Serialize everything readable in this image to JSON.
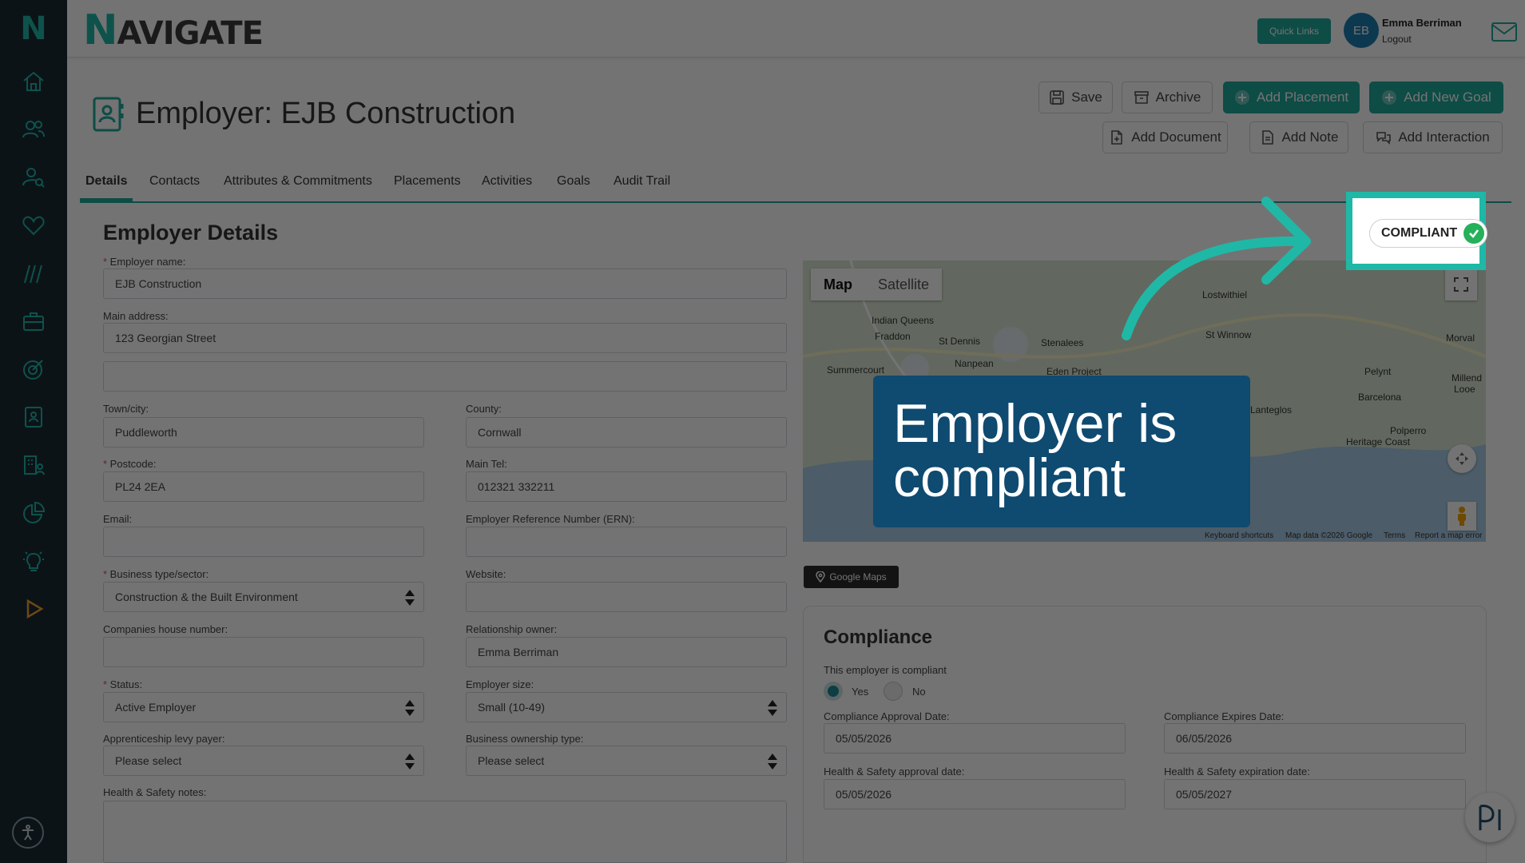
{
  "brand": {
    "initial": "N",
    "rest": "AVIGATE"
  },
  "sidebar": {
    "logo": "N"
  },
  "topbar": {
    "quick_links": "Quick Links",
    "avatar_initials": "EB",
    "user_name": "Emma Berriman",
    "logout": "Logout"
  },
  "header": {
    "title": "Employer: EJB Construction",
    "buttons": {
      "save": "Save",
      "archive": "Archive",
      "add_placement": "Add Placement",
      "add_new_goal": "Add New Goal",
      "add_document": "Add Document",
      "add_note": "Add Note",
      "add_interaction": "Add Interaction"
    }
  },
  "tabs": [
    "Details",
    "Contacts",
    "Attributes & Commitments",
    "Placements",
    "Activities",
    "Goals",
    "Audit Trail"
  ],
  "form": {
    "section_title": "Employer Details",
    "employer_name": {
      "label": "Employer name:",
      "value": "EJB Construction"
    },
    "main_address": {
      "label": "Main address:",
      "value": "123 Georgian Street",
      "line2": ""
    },
    "town": {
      "label": "Town/city:",
      "value": "Puddleworth"
    },
    "county": {
      "label": "County:",
      "value": "Cornwall"
    },
    "postcode": {
      "label": "Postcode:",
      "value": "PL24 2EA"
    },
    "main_tel": {
      "label": "Main Tel:",
      "value": "012321 332211"
    },
    "email": {
      "label": "Email:",
      "value": ""
    },
    "ern": {
      "label": "Employer Reference Number (ERN):",
      "value": ""
    },
    "business_type": {
      "label": "Business type/sector:",
      "value": "Construction & the Built Environment"
    },
    "website": {
      "label": "Website:",
      "value": ""
    },
    "companies_house": {
      "label": "Companies house number:",
      "value": ""
    },
    "relationship_owner": {
      "label": "Relationship owner:",
      "value": "Emma Berriman"
    },
    "status": {
      "label": "Status:",
      "value": "Active Employer"
    },
    "employer_size": {
      "label": "Employer size:",
      "value": "Small (10-49)"
    },
    "levy_payer": {
      "label": "Apprenticeship levy payer:",
      "value": "Please select"
    },
    "ownership_type": {
      "label": "Business ownership type:",
      "value": "Please select"
    },
    "hs_notes": {
      "label": "Health & Safety notes:",
      "value": ""
    }
  },
  "map": {
    "tab_map": "Map",
    "tab_satellite": "Satellite",
    "places": [
      "Lostwithiel",
      "Indian Queens",
      "Fraddon",
      "St Dennis",
      "Stenalees",
      "St Winnow",
      "Morval",
      "Summercourt",
      "Nanpean",
      "Eden Project",
      "Pelynt",
      "Millend",
      "Looe",
      "Barcelona",
      "Lanteglos",
      "Polperro",
      "Heritage Coast"
    ],
    "footer": [
      "Keyboard shortcuts",
      "Map data ©2026 Google",
      "Terms",
      "Report a map error"
    ],
    "google_maps_button": "Google Maps"
  },
  "compliance": {
    "title": "Compliance",
    "is_compliant_label": "This employer is compliant",
    "yes": "Yes",
    "no": "No",
    "approval_date": {
      "label": "Compliance Approval Date:",
      "value": "05/05/2026"
    },
    "expires_date": {
      "label": "Compliance Expires Date:",
      "value": "06/05/2026"
    },
    "hs_approval": {
      "label": "Health & Safety approval date:",
      "value": "05/05/2026"
    },
    "hs_expiration": {
      "label": "Health & Safety expiration date:",
      "value": "05/05/2027"
    }
  },
  "badge": {
    "label": "COMPLIANT"
  },
  "callout": {
    "line1": "Employer is",
    "line2": "compliant"
  },
  "colors": {
    "teal": "#1fa89b",
    "navy_callout": "#0f4a70",
    "sidebar": "#1c2a33",
    "highlight": "#1fb8a6",
    "green_tick": "#25b05a"
  }
}
